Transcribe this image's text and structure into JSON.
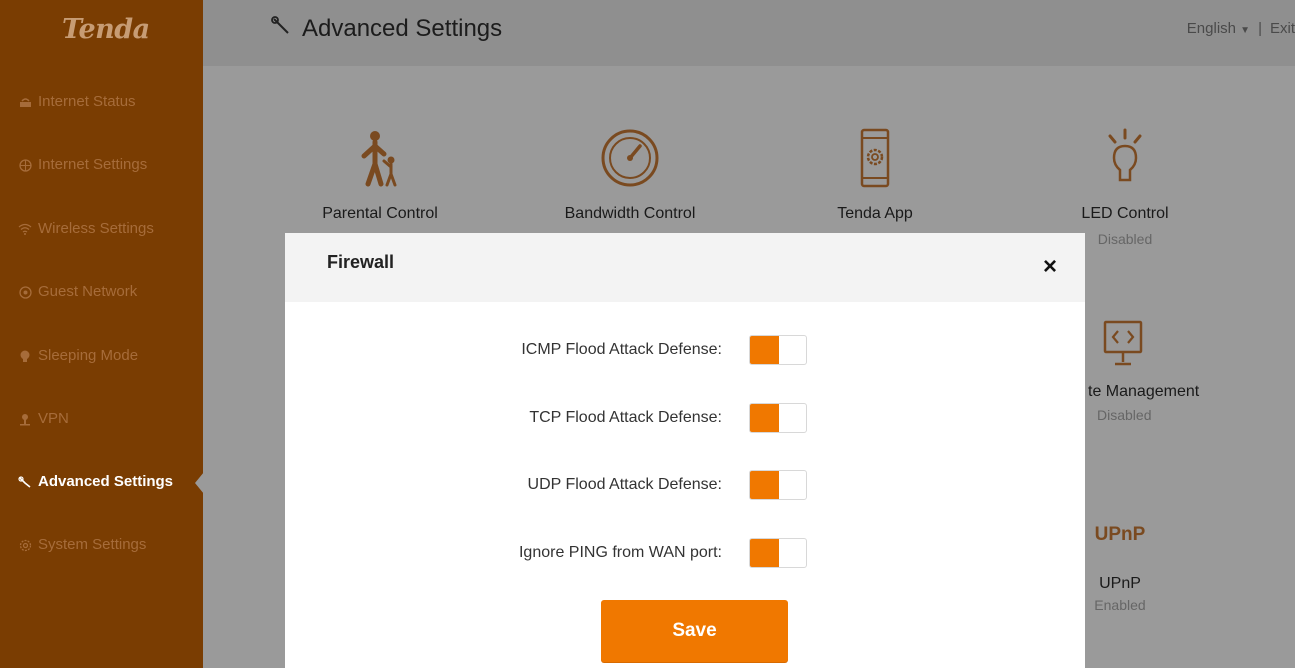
{
  "brand": {
    "logo": "Tenda"
  },
  "sidebar": {
    "items": [
      {
        "label": "Internet Status",
        "icon": "router-icon"
      },
      {
        "label": "Internet Settings",
        "icon": "globe-icon"
      },
      {
        "label": "Wireless Settings",
        "icon": "wifi-icon"
      },
      {
        "label": "Guest Network",
        "icon": "guest-icon"
      },
      {
        "label": "Sleeping Mode",
        "icon": "bulb-icon"
      },
      {
        "label": "VPN",
        "icon": "vpn-icon"
      },
      {
        "label": "Advanced Settings",
        "icon": "wrench-icon",
        "active": true
      },
      {
        "label": "System Settings",
        "icon": "gear-icon"
      }
    ]
  },
  "header": {
    "title": "Advanced Settings",
    "language": "English",
    "separator": "|",
    "exit": "Exit"
  },
  "tiles": {
    "parental": {
      "label": "Parental Control"
    },
    "bandwidth": {
      "label": "Bandwidth Control"
    },
    "app": {
      "label": "Tenda App"
    },
    "led": {
      "label": "LED Control",
      "status": "Disabled"
    },
    "remote": {
      "label": "te Management",
      "status": "Disabled"
    },
    "upnp": {
      "label": "UPnP",
      "status": "Enabled",
      "logo": "UPnP"
    }
  },
  "modal": {
    "title": "Firewall",
    "close": "×",
    "settings": [
      {
        "label": "ICMP Flood Attack Defense:",
        "enabled": true
      },
      {
        "label": "TCP Flood Attack Defense:",
        "enabled": true
      },
      {
        "label": "UDP Flood Attack Defense:",
        "enabled": true
      },
      {
        "label": "Ignore PING from WAN port:",
        "enabled": true
      }
    ],
    "save_label": "Save"
  },
  "colors": {
    "accent": "#f07800",
    "sidebar": "#7a3d02"
  }
}
